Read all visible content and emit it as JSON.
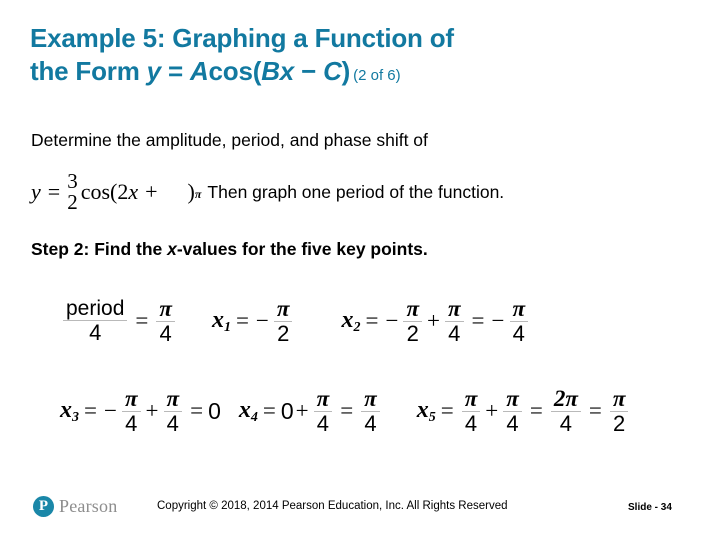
{
  "slide": {
    "title": {
      "line1": "Example 5: Graphing a Function of",
      "line2_prefix": "the Form ",
      "line2_y": "y",
      "line2_eq": " = ",
      "line2_acos": "A",
      "line2_cos": "cos(",
      "line2_b": "B",
      "line2_x": "x",
      "line2_minus": " − ",
      "line2_c": "C",
      "line2_close": ")",
      "count": "(2 of 6)",
      "color": "#1279a0"
    },
    "prompt": {
      "line1": "Determine the amplitude, period, and phase shift of",
      "equation": {
        "lhs_var": "y",
        "equals": "=",
        "coefficient_num": "3",
        "coefficient_den": "2",
        "function": "cos(",
        "inner_coefficient": "2",
        "inner_var": "x",
        "inner_op": "+",
        "inner_pi": "π",
        "close": ")",
        "period_mark": "."
      },
      "after_equation": "Then graph one period of the function."
    },
    "step": {
      "label": "Step 2: Find the ",
      "italic_x": "x",
      "rest": "-values for the five key points."
    },
    "math": {
      "rows": [
        [
          {
            "name": "period-over-four",
            "lhs_num": "period",
            "lhs_den": "4",
            "eq": "=",
            "rhs_num": "π",
            "rhs_den": "4"
          },
          {
            "name": "x1",
            "label": "x",
            "sub": "1",
            "eq": "=",
            "sign": "−",
            "num": "π",
            "den": "2"
          },
          {
            "name": "x2",
            "label": "x",
            "sub": "2",
            "eq": "=",
            "sign": "−",
            "num1": "π",
            "den1": "2",
            "op": "+",
            "num2": "π",
            "den2": "4",
            "eq2": "=",
            "sign2": "−",
            "num3": "π",
            "den3": "4"
          }
        ],
        [
          {
            "name": "x3",
            "label": "x",
            "sub": "3",
            "eq": "=",
            "sign": "−",
            "num1": "π",
            "den1": "4",
            "op": "+",
            "num2": "π",
            "den2": "4",
            "eq2": "=",
            "result": "0"
          },
          {
            "name": "x4",
            "label": "x",
            "sub": "4",
            "eq": "=",
            "first": "0",
            "op": "+",
            "num1": "π",
            "den1": "4",
            "eq2": "=",
            "num2": "π",
            "den2": "4"
          },
          {
            "name": "x5",
            "label": "x",
            "sub": "5",
            "eq": "=",
            "num1": "π",
            "den1": "4",
            "op": "+",
            "num2": "π",
            "den2": "4",
            "eq2": "=",
            "num3": "2π",
            "den3": "4",
            "eq3": "=",
            "num4": "π",
            "den4": "2"
          }
        ]
      ]
    },
    "footer": {
      "logo_mark": "P",
      "logo_word": "Pearson",
      "copyright": "Copyright © 2018, 2014 Pearson Education, Inc. All Rights Reserved",
      "slide_number": "Slide - 34"
    }
  }
}
